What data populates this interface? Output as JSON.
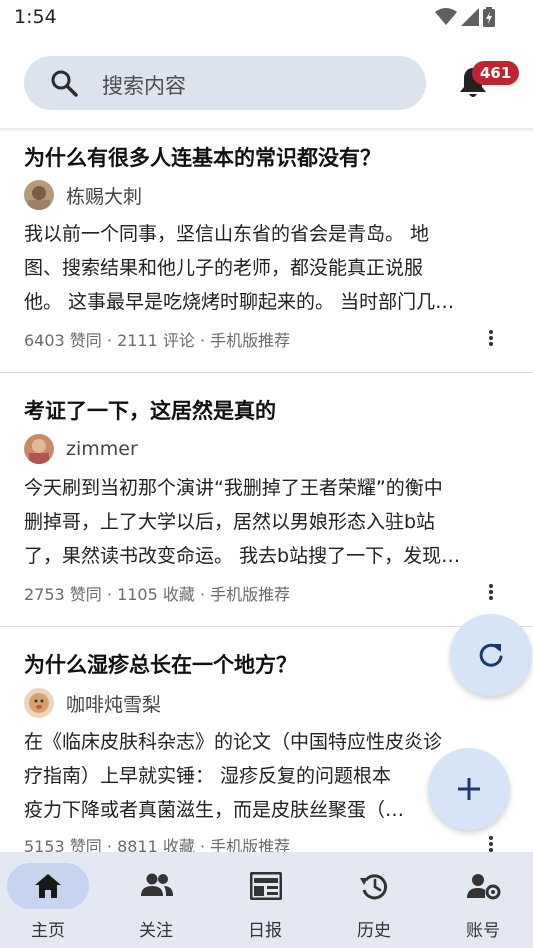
{
  "status_bar": {
    "time": "1:54",
    "icons": [
      "wifi-icon",
      "signal-icon",
      "battery-icon"
    ]
  },
  "header": {
    "search_placeholder": "搜索内容",
    "notification_count": "461",
    "icons": [
      "search-icon",
      "bell-icon"
    ]
  },
  "colors": {
    "accent": "#c02430",
    "search_bg": "#dce3ef",
    "nav_bg": "#e4e8f2",
    "fab_bg": "#d7e4f8"
  },
  "feed": {
    "items": [
      {
        "title": "为什么有很多人连基本的常识都没有？",
        "author": "栋赐大刺",
        "excerpt": [
          "我以前一个同事，坚信山东省的省会是青岛。 地",
          "图、搜索结果和他儿子的老师，都没能真正说服",
          "他。 这事最早是吃烧烤时聊起来的。 当时部门几…"
        ],
        "meta": "6403 赞同 · 2111 评论 · 手机版推荐"
      },
      {
        "title": "考证了一下，这居然是真的",
        "author": "zimmer",
        "excerpt": [
          "今天刷到当初那个演讲“我删掉了王者荣耀”的衡中",
          "删掉哥，上了大学以后，居然以男娘形态入驻b站",
          "了，果然读书改变命运。 我去b站搜了一下，发现…"
        ],
        "meta": "2753 赞同 · 1105 收藏 · 手机版推荐"
      },
      {
        "title": "为什么湿疹总长在一个地方？",
        "author": "咖啡炖雪梨",
        "excerpt": [
          "在《临床皮肤科杂志》的论文（中国特应性皮炎诊",
          "疗指南）上早就实锤： 湿疹反复的问题根本",
          "疫力下降或者真菌滋生，而是皮肤丝聚蛋（…"
        ],
        "meta": "5153 赞同 · 8811 收藏 · 手机版推荐"
      }
    ]
  },
  "fabs": {
    "refresh_icon": "refresh-icon",
    "add_icon": "add-icon"
  },
  "bottom_nav": {
    "items": [
      {
        "label": "主页",
        "icon": "home-icon",
        "active": true
      },
      {
        "label": "关注",
        "icon": "people-icon",
        "active": false
      },
      {
        "label": "日报",
        "icon": "newspaper-icon",
        "active": false
      },
      {
        "label": "历史",
        "icon": "history-icon",
        "active": false
      },
      {
        "label": "账号",
        "icon": "account-settings-icon",
        "active": false
      }
    ]
  }
}
